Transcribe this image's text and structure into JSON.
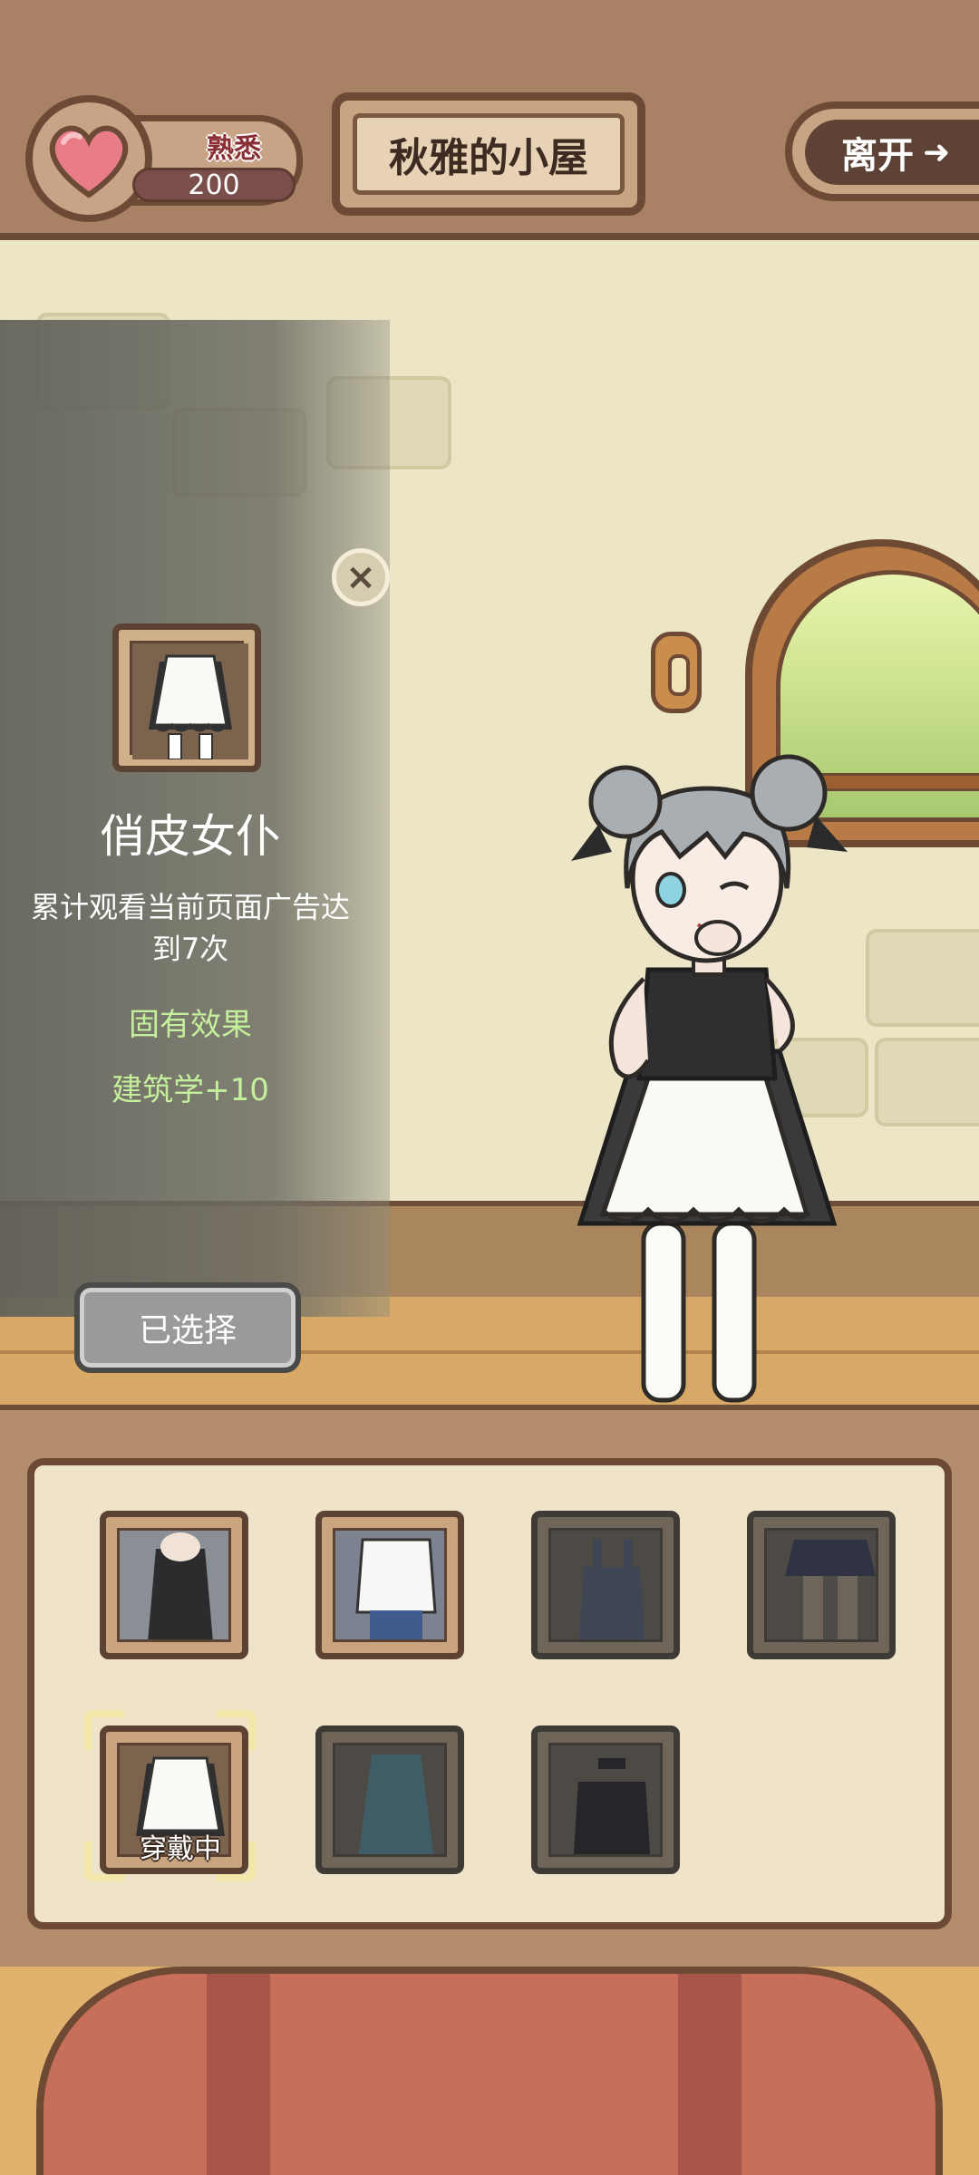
{
  "header": {
    "familiarity_label": "熟悉",
    "familiarity_value": "200",
    "room_title": "秋雅的小屋",
    "leave_label": "离开"
  },
  "outfit_detail": {
    "name": "俏皮女仆",
    "unlock_condition": "累计观看当前页面广告达到7次",
    "effect_heading": "固有效果",
    "effect": "建筑学+10",
    "selected_label": "已选择"
  },
  "wardrobe": {
    "items": [
      {
        "name": "black-dress",
        "locked": false
      },
      {
        "name": "white-shirt-jeans",
        "locked": false
      },
      {
        "name": "overalls",
        "locked": true
      },
      {
        "name": "skirt",
        "locked": true
      },
      {
        "name": "maid-outfit",
        "locked": false,
        "wearing": true
      },
      {
        "name": "teal-dress",
        "locked": true
      },
      {
        "name": "black-top",
        "locked": true
      }
    ],
    "wearing_label": "穿戴中"
  },
  "colors": {
    "frame_brown": "#6c4a36",
    "panel_cream": "#efe3c9",
    "effect_green": "#c4f09c",
    "heart_pink": "#e87c87"
  }
}
